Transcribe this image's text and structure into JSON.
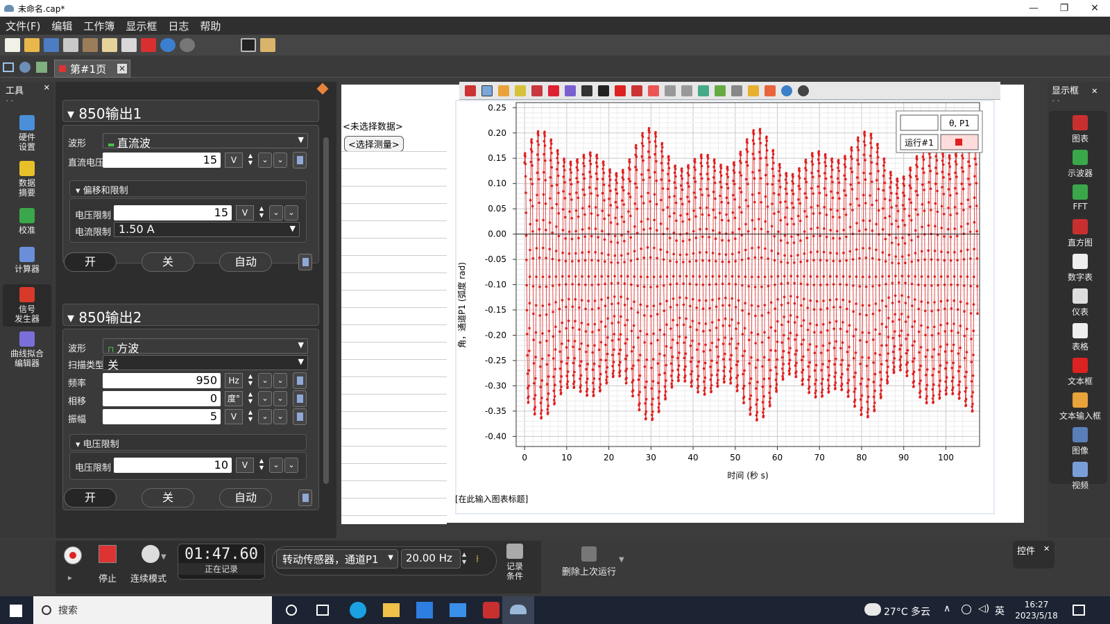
{
  "window": {
    "title": "未命名.cap*",
    "min": "—",
    "max": "❐",
    "close": "✕"
  },
  "menu": [
    "文件(F)",
    "编辑",
    "工作簿",
    "显示框",
    "日志",
    "帮助"
  ],
  "tab": {
    "label": "第#1页",
    "close": "✕"
  },
  "tools_panel": {
    "title": "工具",
    "close": "✕",
    "more": "⠄⠄"
  },
  "tools": [
    {
      "label": "硬件\n设置",
      "icon": "hardware-setup-icon"
    },
    {
      "label": "数据\n摘要",
      "icon": "data-summary-icon"
    },
    {
      "label": "校准",
      "icon": "calibration-icon"
    },
    {
      "label": "计算器",
      "icon": "calculator-icon"
    },
    {
      "label": "信号\n发生器",
      "icon": "signal-generator-icon"
    },
    {
      "label": "曲线拟合\n编辑器",
      "icon": "curve-fit-icon"
    }
  ],
  "out1": {
    "title": "850输出1",
    "waveform_label": "波形",
    "waveform": "直流波",
    "dc_label": "直流电压",
    "dc_value": "15",
    "dc_unit": "V",
    "offset_title": "偏移和限制",
    "vlimit_label": "电压限制",
    "vlimit_value": "15",
    "vlimit_unit": "V",
    "ilimit_label": "电流限制",
    "ilimit_value": "1.50 A",
    "on": "开",
    "off": "关",
    "auto": "自动"
  },
  "out2": {
    "title": "850输出2",
    "waveform_label": "波形",
    "waveform": "方波",
    "sweep_label": "扫描类型",
    "sweep": "关",
    "freq_label": "频率",
    "freq_value": "950",
    "freq_unit": "Hz",
    "phase_label": "相移",
    "phase_value": "0",
    "phase_unit": "度°",
    "amp_label": "振幅",
    "amp_value": "5",
    "amp_unit": "V",
    "vlim_title": "电压限制",
    "vlimit_label": "电压限制",
    "vlimit_value": "10",
    "vlimit_unit": "V",
    "on": "开",
    "off": "关",
    "auto": "自动"
  },
  "table": {
    "no_data": "<未选择数据>",
    "select": "<选择测量>"
  },
  "graph_title_placeholder": "[在此输入图表标题]",
  "legend": {
    "series": "θ, P1",
    "run": "运行#1"
  },
  "chart_data": {
    "type": "scatter",
    "x_label": "时间 (秒 s)",
    "y_label": "角，通道P1 (弧度 rad)",
    "x_ticks": [
      "0",
      "10",
      "20",
      "30",
      "40",
      "50",
      "60",
      "70",
      "80",
      "90",
      "100"
    ],
    "y_ticks": [
      "0.25",
      "0.20",
      "0.15",
      "0.10",
      "0.05",
      "0.00",
      "-0.05",
      "-0.10",
      "-0.15",
      "-0.20",
      "-0.25",
      "-0.30",
      "-0.35",
      "-0.40"
    ],
    "xlim": [
      -2,
      108
    ],
    "ylim": [
      -0.42,
      0.26
    ],
    "series_color": "#e02020",
    "oscillation": {
      "period_s": 1.55,
      "center": -0.08,
      "amplitude": 0.29,
      "x_start": 0,
      "x_end": 107.5,
      "sample_rate_hz": 20
    }
  },
  "display_panel": {
    "title": "显示框",
    "close": "✕",
    "more": "⠄⠄"
  },
  "displays": [
    {
      "label": "图表",
      "icon": "graph-icon"
    },
    {
      "label": "示波器",
      "icon": "scope-icon"
    },
    {
      "label": "FFT",
      "icon": "fft-icon"
    },
    {
      "label": "直方图",
      "icon": "histogram-icon"
    },
    {
      "label": "数字表",
      "icon": "digits-icon"
    },
    {
      "label": "仪表",
      "icon": "meter-icon"
    },
    {
      "label": "表格",
      "icon": "table-icon"
    },
    {
      "label": "文本框",
      "icon": "textbox-icon"
    },
    {
      "label": "文本输入框",
      "icon": "text-entry-icon"
    },
    {
      "label": "图像",
      "icon": "image-icon"
    },
    {
      "label": "视频",
      "icon": "video-icon"
    }
  ],
  "controls_panel": {
    "title": "控件",
    "close": "✕"
  },
  "record": {
    "stop": "停止",
    "mode": "连续模式",
    "time": "01:47.60",
    "status": "正在记录",
    "sensor": "转动传感器，通道P1",
    "rate": "20.00 Hz",
    "conditions": "记录\n条件",
    "delete_last": "删除上次运行"
  },
  "taskbar": {
    "search": "搜索",
    "weather": "27°C 多云",
    "ime": "英",
    "time": "16:27",
    "date": "2023/5/18"
  }
}
